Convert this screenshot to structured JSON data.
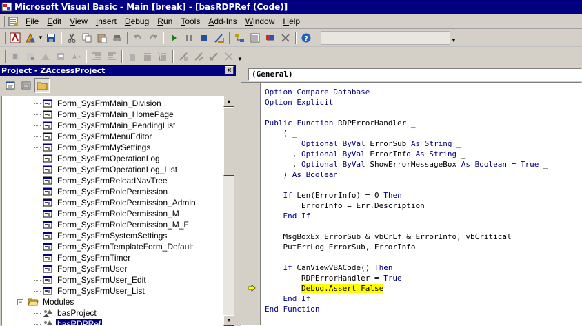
{
  "window": {
    "title": "Microsoft Visual Basic - Main [break] - [basRDPRef (Code)]"
  },
  "menu": [
    {
      "label": "File",
      "key": "F"
    },
    {
      "label": "Edit",
      "key": "E"
    },
    {
      "label": "View",
      "key": "V"
    },
    {
      "label": "Insert",
      "key": "I"
    },
    {
      "label": "Debug",
      "key": "D"
    },
    {
      "label": "Run",
      "key": "R"
    },
    {
      "label": "Tools",
      "key": "T"
    },
    {
      "label": "Add-Ins",
      "key": "A"
    },
    {
      "label": "Window",
      "key": "W"
    },
    {
      "label": "Help",
      "key": "H"
    }
  ],
  "toolbar1": {
    "buttons": [
      "view-access-icon",
      "insert-module-icon",
      "save-icon",
      "cut-icon",
      "copy-icon",
      "paste-icon",
      "find-icon",
      "undo-icon",
      "redo-icon",
      "run-icon",
      "break-icon",
      "reset-icon",
      "design-mode-icon",
      "project-explorer-icon",
      "properties-icon",
      "object-browser-icon",
      "toolbox-icon",
      "help-icon"
    ]
  },
  "toolbar2": {
    "buttons": [
      "list-properties-icon",
      "list-constants-icon",
      "quick-info-icon",
      "parameter-info-icon",
      "complete-word-icon",
      "indent-icon",
      "outdent-icon",
      "toggle-breakpoint-icon",
      "comment-block-icon",
      "uncomment-block-icon",
      "toggle-bookmark-icon",
      "next-bookmark-icon",
      "previous-bookmark-icon",
      "clear-bookmarks-icon"
    ]
  },
  "project": {
    "title": "Project - ZAccessProject",
    "close": "×",
    "tree": [
      {
        "label": "Form_SysFrmMain_Division",
        "kind": "form"
      },
      {
        "label": "Form_SysFrmMain_HomePage",
        "kind": "form"
      },
      {
        "label": "Form_SysFrmMain_PendingList",
        "kind": "form"
      },
      {
        "label": "Form_SysFrmMenuEditor",
        "kind": "form"
      },
      {
        "label": "Form_SysFrmMySettings",
        "kind": "form"
      },
      {
        "label": "Form_SysFrmOperationLog",
        "kind": "form"
      },
      {
        "label": "Form_SysFrmOperationLog_List",
        "kind": "form"
      },
      {
        "label": "Form_SysFrmReloadNavTree",
        "kind": "form"
      },
      {
        "label": "Form_SysFrmRolePermission",
        "kind": "form"
      },
      {
        "label": "Form_SysFrmRolePermission_Admin",
        "kind": "form"
      },
      {
        "label": "Form_SysFrmRolePermission_M",
        "kind": "form"
      },
      {
        "label": "Form_SysFrmRolePermission_M_F",
        "kind": "form"
      },
      {
        "label": "Form_SysFrmSystemSettings",
        "kind": "form"
      },
      {
        "label": "Form_SysFrmTemplateForm_Default",
        "kind": "form"
      },
      {
        "label": "Form_SysFrmTimer",
        "kind": "form"
      },
      {
        "label": "Form_SysFrmUser",
        "kind": "form"
      },
      {
        "label": "Form_SysFrmUser_Edit",
        "kind": "form"
      },
      {
        "label": "Form_SysFrmUser_List",
        "kind": "form"
      },
      {
        "label": "Modules",
        "kind": "folder",
        "expander": "−"
      },
      {
        "label": "basProject",
        "kind": "module"
      },
      {
        "label": "basRDPRef",
        "kind": "module",
        "selected": true
      }
    ]
  },
  "code": {
    "procedure_combo": "(General)",
    "lines": [
      [
        [
          "kw",
          "Option Compare Database"
        ]
      ],
      [
        [
          "kw",
          "Option Explicit"
        ]
      ],
      [],
      [
        [
          "kw",
          "Public Function"
        ],
        [
          "",
          " RDPErrorHandler _"
        ]
      ],
      [
        [
          "",
          "    ( _"
        ]
      ],
      [
        [
          "",
          "        "
        ],
        [
          "kw",
          "Optional ByVal"
        ],
        [
          "",
          " ErrorSub "
        ],
        [
          "kw",
          "As String"
        ],
        [
          "",
          " _"
        ]
      ],
      [
        [
          "",
          "      , "
        ],
        [
          "kw",
          "Optional ByVal"
        ],
        [
          "",
          " ErrorInfo "
        ],
        [
          "kw",
          "As String"
        ],
        [
          "",
          " _"
        ]
      ],
      [
        [
          "",
          "      , "
        ],
        [
          "kw",
          "Optional ByVal"
        ],
        [
          "",
          " ShowErrorMessageBox "
        ],
        [
          "kw",
          "As Boolean"
        ],
        [
          "",
          " = "
        ],
        [
          "kw",
          "True"
        ],
        [
          "",
          " _"
        ]
      ],
      [
        [
          "",
          "    ) "
        ],
        [
          "kw",
          "As Boolean"
        ]
      ],
      [],
      [
        [
          "",
          "    "
        ],
        [
          "kw",
          "If"
        ],
        [
          "",
          " Len(ErrorInfo) = 0 "
        ],
        [
          "kw",
          "Then"
        ]
      ],
      [
        [
          "",
          "        ErrorInfo = Err.Description"
        ]
      ],
      [
        [
          "",
          "    "
        ],
        [
          "kw",
          "End If"
        ]
      ],
      [],
      [
        [
          "",
          "    MsgBoxEx ErrorSub & vbCrLf & ErrorInfo, vbCritical"
        ]
      ],
      [
        [
          "",
          "    PutErrLog ErrorSub, ErrorInfo"
        ]
      ],
      [],
      [
        [
          "",
          "    "
        ],
        [
          "kw",
          "If"
        ],
        [
          "",
          " CanViewVBACode() "
        ],
        [
          "kw",
          "Then"
        ]
      ],
      [
        [
          "",
          "        RDPErrorHandler = "
        ],
        [
          "kw",
          "True"
        ]
      ],
      [
        [
          "",
          "        "
        ],
        [
          "hl",
          "Debug.Assert False"
        ]
      ],
      [
        [
          "",
          "    "
        ],
        [
          "kw",
          "End If"
        ]
      ],
      [
        [
          "kw",
          "End Function"
        ]
      ]
    ],
    "execution_line": 19
  }
}
